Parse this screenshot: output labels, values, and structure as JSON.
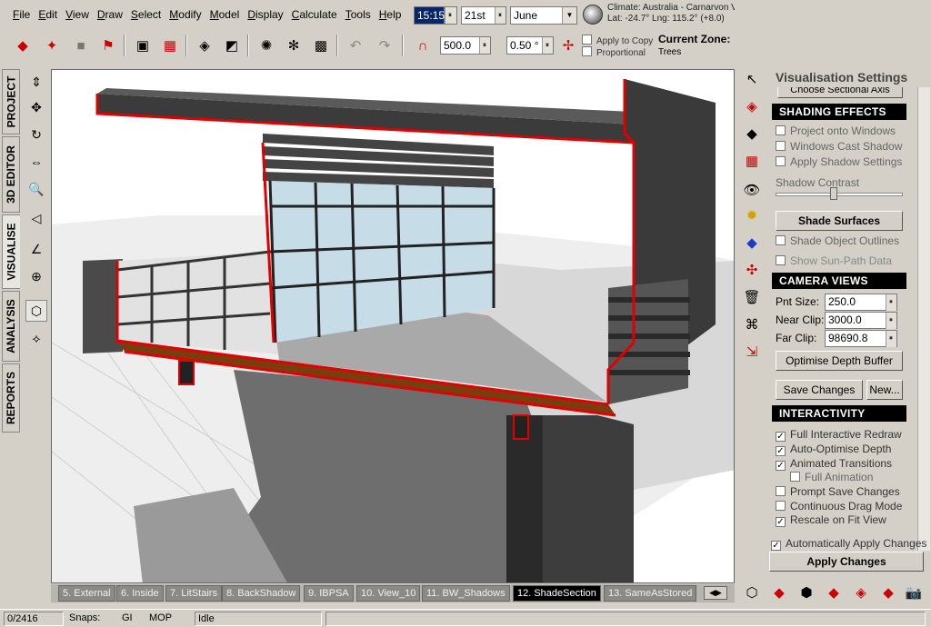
{
  "menu": [
    "File",
    "Edit",
    "View",
    "Draw",
    "Select",
    "Modify",
    "Model",
    "Display",
    "Calculate",
    "Tools",
    "Help"
  ],
  "datetime": {
    "time": "15:15",
    "day": "21st",
    "month": "June"
  },
  "climate": {
    "line1": "Climate: Australia - Carnarvon V",
    "line2": "Lat: -24.7°   Lng: 115.2° (+8.0)"
  },
  "toolbar": {
    "distance": "500.0",
    "angle": "0.50 °",
    "apply_to_copy": "Apply to Copy",
    "proportional": "Proportional",
    "current_zone_label": "Current Zone:",
    "current_zone_value": "Trees"
  },
  "left_tabs": [
    "PROJECT",
    "3D EDITOR",
    "VISUALISE",
    "ANALYSIS",
    "REPORTS"
  ],
  "bottom_tabs": [
    "5. External",
    "6. Inside",
    "7. LitStairs",
    "8. BackShadow",
    "9. IBPSA",
    "10. View_10",
    "11. BW_Shadows",
    "12. ShadeSection",
    "13. SameAsStored"
  ],
  "active_tab": "12. ShadeSection",
  "status": {
    "count": "0/2416",
    "snaps_label": "Snaps:",
    "snap_gi": "GI",
    "snap_mop": "MOP",
    "state": "Idle"
  },
  "panel": {
    "title": "Visualisation Settings",
    "sectional_axis": "Choose Sectional Axis",
    "shading": {
      "header": "SHADING EFFECTS",
      "project_onto_windows": "Project onto Windows",
      "windows_cast_shadow": "Windows Cast Shadow",
      "apply_shadow_settings": "Apply Shadow Settings",
      "shadow_contrast": "Shadow Contrast",
      "shade_surfaces": "Shade Surfaces",
      "shade_object_outlines": "Shade Object Outlines",
      "show_sunpath": "Show Sun-Path Data"
    },
    "camera": {
      "header": "CAMERA VIEWS",
      "pnt_size_label": "Pnt Size:",
      "pnt_size": "250.0",
      "near_clip_label": "Near Clip:",
      "near_clip": "3000.0",
      "far_clip_label": "Far Clip:",
      "far_clip": "98690.8",
      "optimise": "Optimise Depth Buffer",
      "save_changes": "Save Changes",
      "new": "New..."
    },
    "interactivity": {
      "header": "INTERACTIVITY",
      "full_redraw": "Full Interactive Redraw",
      "auto_optimise": "Auto-Optimise Depth",
      "animated_transitions": "Animated Transitions",
      "full_animation": "Full Animation",
      "prompt_save": "Prompt Save Changes",
      "continuous_drag": "Continuous Drag Mode",
      "rescale": "Rescale on Fit View"
    },
    "auto_apply": "Automatically Apply Changes",
    "apply_changes": "Apply Changes"
  },
  "colors": {
    "section_red": "#e00000",
    "active_tab": "#000000",
    "header_bg": "#000000"
  }
}
